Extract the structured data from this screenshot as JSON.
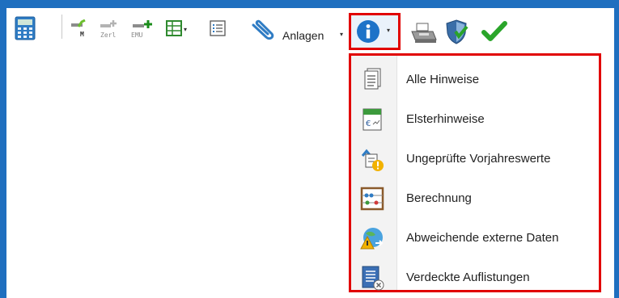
{
  "toolbar": {
    "m_label": "M",
    "zerl_label": "Zerl",
    "emu_label": "EMU",
    "anlagen_label": "Anlagen",
    "info_caret": "▾",
    "dropdown_caret": "▾"
  },
  "menu": {
    "items": [
      {
        "label": "Alle Hinweise",
        "icon": "document-list-icon"
      },
      {
        "label": "Elsterhinweise",
        "icon": "elster-icon"
      },
      {
        "label": "Ungeprüfte Vorjahreswerte",
        "icon": "unchecked-values-icon"
      },
      {
        "label": "Berechnung",
        "icon": "abacus-icon"
      },
      {
        "label": "Abweichende externe Daten",
        "icon": "external-data-warning-icon"
      },
      {
        "label": "Verdeckte Auflistungen",
        "icon": "hidden-list-icon"
      }
    ]
  },
  "colors": {
    "frame": "#1f6fbf",
    "highlight": "#e10000",
    "info_blue": "#1e73c8",
    "check_green": "#2aa52a"
  }
}
